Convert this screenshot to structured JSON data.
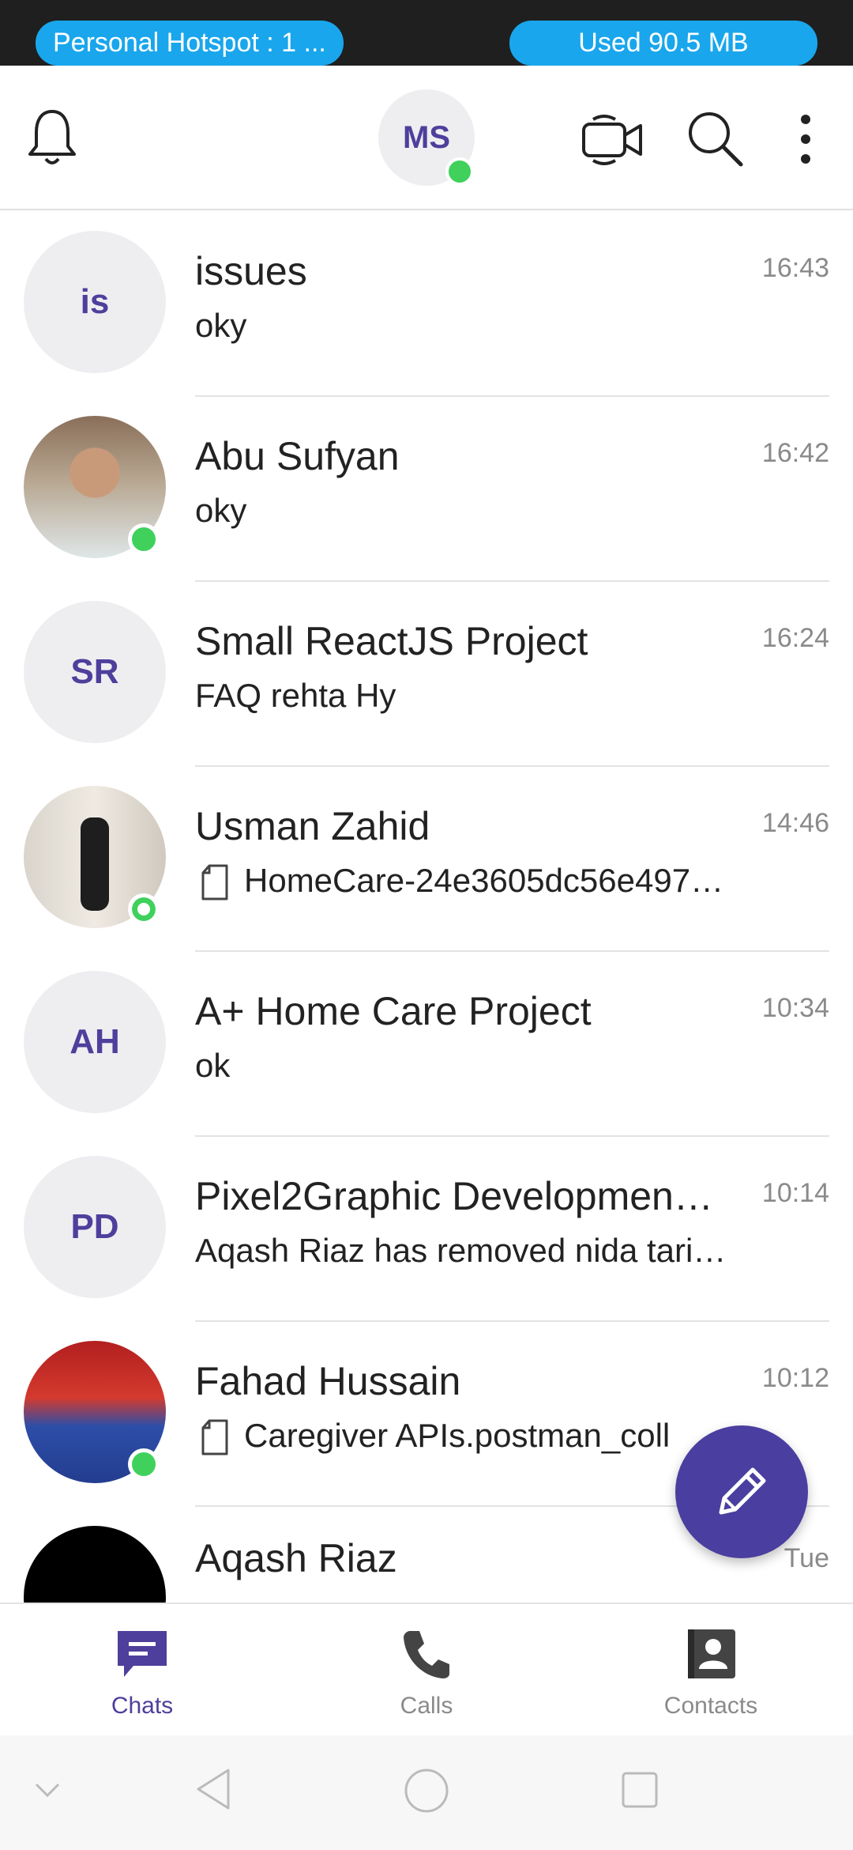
{
  "status_bar": {
    "hotspot_label": "Personal Hotspot : 1 ...",
    "data_used": "Used  90.5 MB"
  },
  "header": {
    "profile_initials": "MS",
    "icons": [
      "bell-icon",
      "video-call-icon",
      "search-icon",
      "more-vert-icon"
    ]
  },
  "chats": [
    {
      "avatar_text": "is",
      "name": "issues",
      "message": "oky",
      "time": "16:43",
      "online": false,
      "attachment": false
    },
    {
      "avatar_text": "",
      "name": "Abu Sufyan",
      "message": "oky",
      "time": "16:42",
      "online": true,
      "attachment": false
    },
    {
      "avatar_text": "SR",
      "name": "Small ReactJS Project",
      "message": "FAQ rehta Hy",
      "time": "16:24",
      "online": false,
      "attachment": false
    },
    {
      "avatar_text": "",
      "name": "Usman Zahid",
      "message": "HomeCare-24e3605dc56e497…",
      "time": "14:46",
      "online": "away",
      "attachment": true
    },
    {
      "avatar_text": "AH",
      "name": "A+ Home Care Project",
      "message": "ok",
      "time": "10:34",
      "online": false,
      "attachment": false
    },
    {
      "avatar_text": "PD",
      "name": "Pixel2Graphic Developmen…",
      "message": "Aqash Riaz has removed nida tari…",
      "time": "10:14",
      "online": false,
      "attachment": false
    },
    {
      "avatar_text": "",
      "name": "Fahad Hussain",
      "message": "Caregiver APIs.postman_coll",
      "time": "10:12",
      "online": true,
      "attachment": true
    },
    {
      "avatar_text": "",
      "name": "Aqash Riaz",
      "message": "",
      "time": "Tue",
      "online": false,
      "attachment": false
    }
  ],
  "fab": {
    "icon": "pencil-icon"
  },
  "bottom_nav": {
    "tabs": [
      {
        "label": "Chats",
        "icon": "chat-icon",
        "active": true
      },
      {
        "label": "Calls",
        "icon": "phone-icon",
        "active": false
      },
      {
        "label": "Contacts",
        "icon": "contacts-icon",
        "active": false
      }
    ]
  },
  "colors": {
    "accent": "#4e3f9c",
    "fab": "#4a3ea0",
    "online": "#3fd15b",
    "status_pill": "#19a6ec",
    "status_bar": "#1f1f1f"
  }
}
